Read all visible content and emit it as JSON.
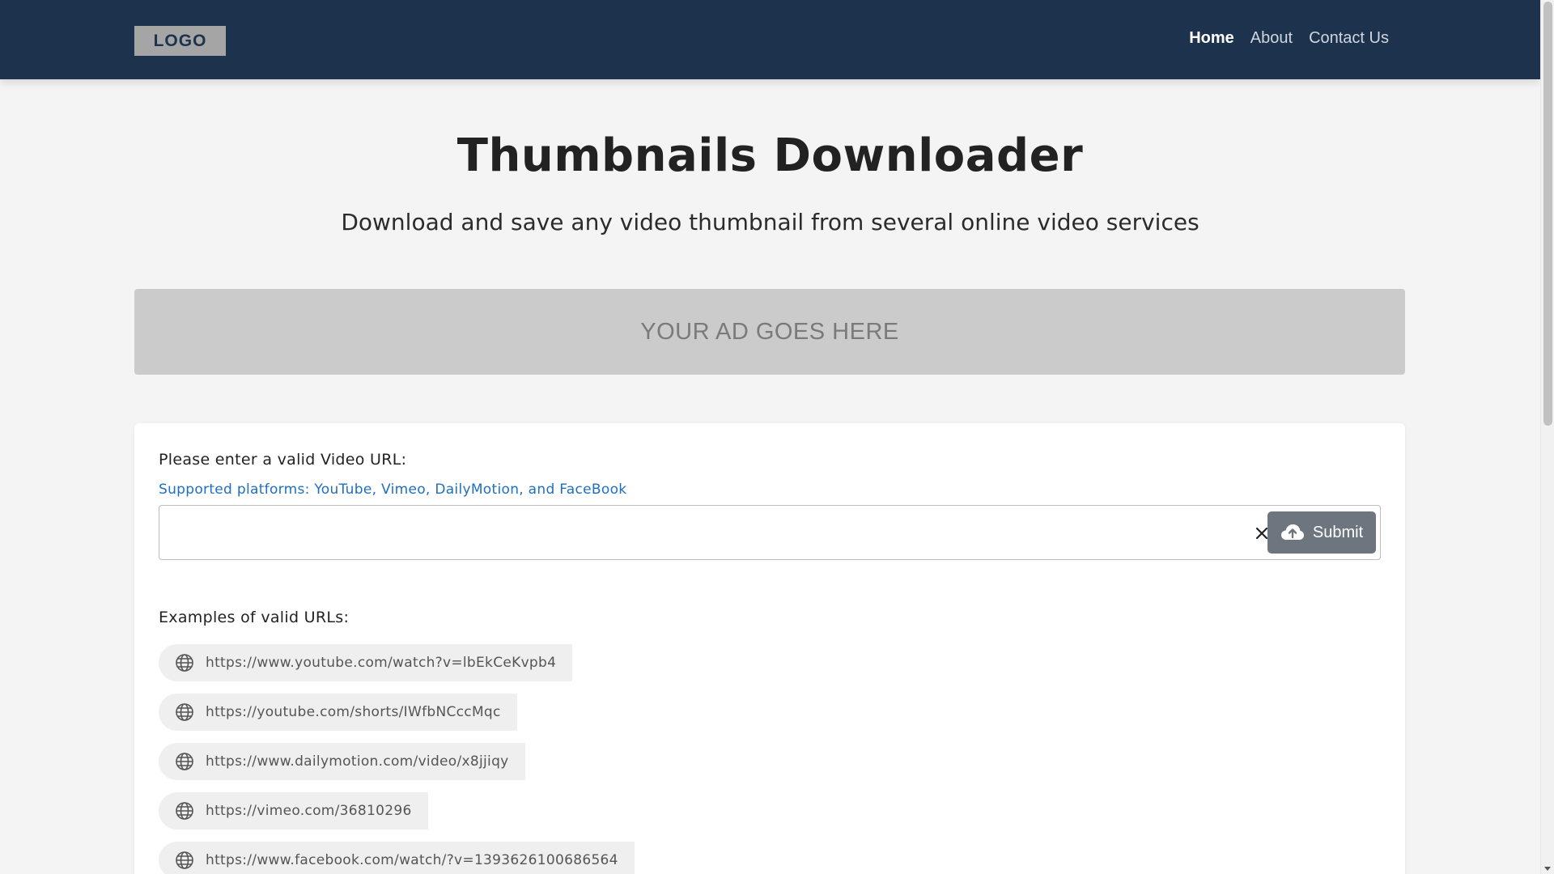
{
  "header": {
    "logo": "LOGO",
    "nav": [
      {
        "label": "Home",
        "active": true
      },
      {
        "label": "About",
        "active": false
      },
      {
        "label": "Contact Us",
        "active": false
      }
    ]
  },
  "hero": {
    "title": "Thumbnails Downloader",
    "subtitle": "Download and save any video thumbnail from several online video services"
  },
  "ad": {
    "text": "YOUR AD GOES HERE"
  },
  "form": {
    "label": "Please enter a valid Video URL:",
    "hint": "Supported platforms: YouTube, Vimeo, DailyMotion, and FaceBook",
    "input_value": "",
    "clear_icon": "close-icon",
    "submit_label": "Submit",
    "submit_icon": "cloud-upload-icon"
  },
  "examples": {
    "label": "Examples of valid URLs:",
    "icon": "globe-icon",
    "urls": [
      "https://www.youtube.com/watch?v=lbEkCeKvpb4",
      "https://youtube.com/shorts/IWfbNCccMqc",
      "https://www.dailymotion.com/video/x8jjiqy",
      "https://vimeo.com/36810296",
      "https://www.facebook.com/watch/?v=1393626100686564"
    ]
  },
  "colors": {
    "navbar": "#1d324c",
    "accent_link": "#1e6fc0",
    "submit": "#6d757e",
    "ad_bg": "#cbcbcb"
  }
}
